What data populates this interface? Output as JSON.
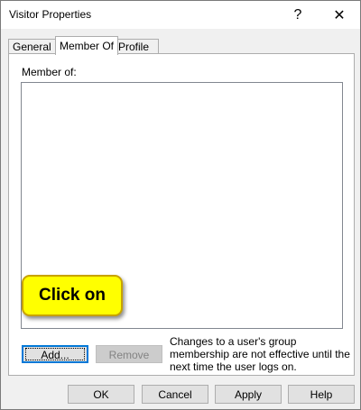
{
  "window": {
    "title": "Visitor Properties",
    "help_glyph": "?",
    "close_glyph": "✕"
  },
  "tabs": [
    {
      "label": "General",
      "active": false
    },
    {
      "label": "Member Of",
      "active": true
    },
    {
      "label": "Profile",
      "active": false
    }
  ],
  "member_of": {
    "label": "Member of:",
    "items": []
  },
  "buttons": {
    "add": "Add...",
    "remove": "Remove",
    "ok": "OK",
    "cancel": "Cancel",
    "apply": "Apply",
    "help": "Help"
  },
  "note": "Changes to a user's group membership are not effective until the next time the user logs on.",
  "callout": {
    "text": "Click on",
    "fill_color": "#ffff00",
    "border_color": "#c8a200"
  },
  "colors": {
    "focus_border": "#0078d7",
    "dialog_bg": "#f0f0f0"
  }
}
